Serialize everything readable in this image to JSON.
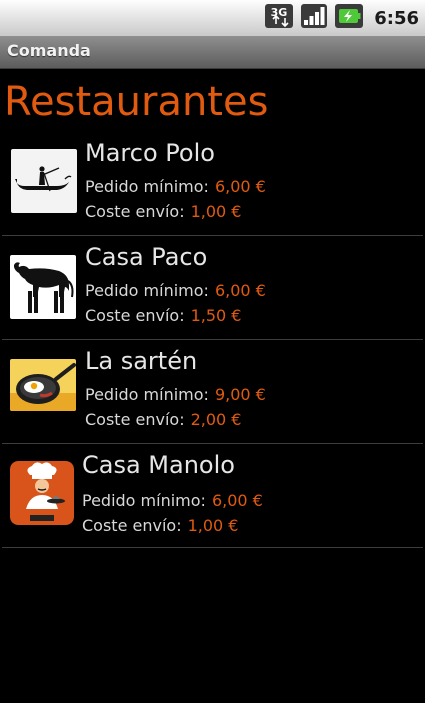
{
  "status_bar": {
    "time": "6:56",
    "network_label": "3G",
    "icons": [
      "network-3g-icon",
      "signal-icon",
      "battery-charging-icon"
    ]
  },
  "app": {
    "title": "Comanda"
  },
  "page": {
    "heading": "Restaurantes"
  },
  "colors": {
    "accent": "#e05a10",
    "background": "#000000",
    "title_bar": "#6e6e6e"
  },
  "restaurants": [
    {
      "name": "Marco Polo",
      "min_order_label": "Pedido mínimo:",
      "min_order": "6,00 €",
      "shipping_label": "Coste envío:",
      "shipping": "1,00 €",
      "icon": "gondola-icon"
    },
    {
      "name": "Casa Paco",
      "min_order_label": "Pedido mínimo:",
      "min_order": "6,00 €",
      "shipping_label": "Coste envío:",
      "shipping": "1,50 €",
      "icon": "bull-icon"
    },
    {
      "name": "La sartén",
      "min_order_label": "Pedido mínimo:",
      "min_order": "9,00 €",
      "shipping_label": "Coste envío:",
      "shipping": "2,00 €",
      "icon": "frying-pan-icon"
    },
    {
      "name": "Casa Manolo",
      "min_order_label": "Pedido mínimo:",
      "min_order": "6,00 €",
      "shipping_label": "Coste envío:",
      "shipping": "1,00 €",
      "icon": "chef-icon"
    }
  ]
}
